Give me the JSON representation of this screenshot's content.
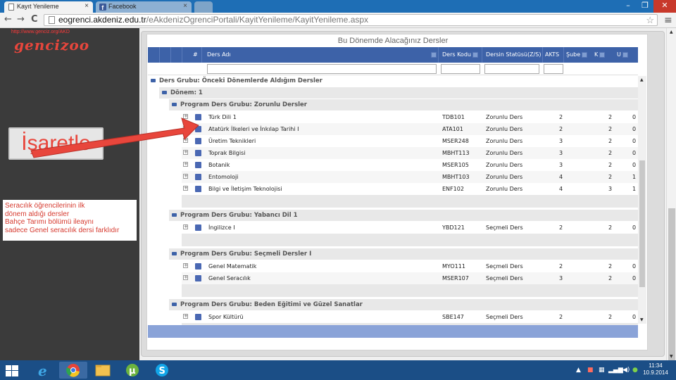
{
  "browser": {
    "tabs": [
      {
        "title": "Kayıt Yenileme",
        "active": true
      },
      {
        "title": "Facebook",
        "active": false
      }
    ],
    "url_host": "eogrenci.akdeniz.edu.tr",
    "url_path": "/eAkdenizOgrenciPortali/KayitYenileme/KayitYenileme.aspx",
    "close_glyph": "×",
    "min_glyph": "–",
    "max_glyph": "❐",
    "win_close_glyph": "✕",
    "back_glyph": "←",
    "fwd_glyph": "→",
    "reload_glyph": "C",
    "star_glyph": "☆",
    "menu_glyph": "≡"
  },
  "sidebar": {
    "site_url": "http://www.genciz.org/AKD",
    "logo_text": "genciz",
    "logo_dots": "oo",
    "mark_label": "İşaretle",
    "note_lines": [
      "Seracılık öğrencilerinin ilk",
      "dönem aldığı dersler",
      " Bahçe Tarımı bölümü ileaynı",
      " sadece Genel seracılık dersi farklıdır"
    ]
  },
  "grid": {
    "caption": "Bu Dönemde Alacağınız Dersler",
    "columns": {
      "no": "#",
      "name": "Ders Adı",
      "code": "Ders Kodu",
      "status": "Dersin Statüsü(Z/S)",
      "akts": "AKTS",
      "section": "Şube",
      "k": "K",
      "u": "U"
    },
    "group_top": "Ders Grubu: Önceki Dönemlerde Aldığım Dersler",
    "term": "Dönem: 1",
    "groups": [
      {
        "title": "Program Ders Grubu: Zorunlu Dersler",
        "rows": [
          {
            "name": "Türk Dili 1",
            "code": "TDB101",
            "status": "Zorunlu Ders",
            "akts": "2",
            "k": "2",
            "u": "0"
          },
          {
            "name": "Atatürk İlkeleri ve İnkılap Tarihi I",
            "code": "ATA101",
            "status": "Zorunlu Ders",
            "akts": "2",
            "k": "2",
            "u": "0"
          },
          {
            "name": "Üretim Teknikleri",
            "code": "MSER248",
            "status": "Zorunlu Ders",
            "akts": "3",
            "k": "2",
            "u": "0"
          },
          {
            "name": "Toprak Bilgisi",
            "code": "MBHT113",
            "status": "Zorunlu Ders",
            "akts": "3",
            "k": "2",
            "u": "0"
          },
          {
            "name": "Botanik",
            "code": "MSER105",
            "status": "Zorunlu Ders",
            "akts": "3",
            "k": "2",
            "u": "0"
          },
          {
            "name": "Entomoloji",
            "code": "MBHT103",
            "status": "Zorunlu Ders",
            "akts": "4",
            "k": "2",
            "u": "1"
          },
          {
            "name": "Bilgi ve İletişim Teknolojisi",
            "code": "ENF102",
            "status": "Zorunlu Ders",
            "akts": "4",
            "k": "3",
            "u": "1"
          }
        ]
      },
      {
        "title": "Program Ders Grubu: Yabancı Dil 1",
        "rows": [
          {
            "name": "İngilizce I",
            "code": "YBD121",
            "status": "Seçmeli Ders",
            "akts": "2",
            "k": "2",
            "u": "0"
          }
        ]
      },
      {
        "title": "Program Ders Grubu: Seçmeli Dersler I",
        "rows": [
          {
            "name": "Genel Matematik",
            "code": "MYO111",
            "status": "Seçmeli Ders",
            "akts": "2",
            "k": "2",
            "u": "0"
          },
          {
            "name": "Genel Seracılık",
            "code": "MSER107",
            "status": "Seçmeli Ders",
            "akts": "3",
            "k": "2",
            "u": "0"
          }
        ]
      },
      {
        "title": "Program Ders Grubu: Beden Eğitimi ve Güzel Sanatlar",
        "rows": [
          {
            "name": "Spor Kültürü",
            "code": "SBE147",
            "status": "Seçmeli Ders",
            "akts": "2",
            "k": "2",
            "u": "0"
          }
        ]
      }
    ]
  },
  "taskbar": {
    "time": "11:34",
    "date": "10.9.2014"
  },
  "colors": {
    "header_blue": "#3d62a8",
    "arrow_red": "#e8463c",
    "taskbar": "#1b4e86"
  }
}
